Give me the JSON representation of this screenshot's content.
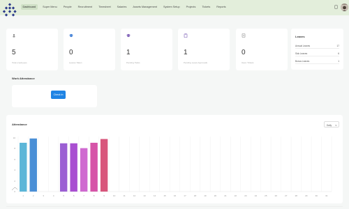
{
  "nav": {
    "items": [
      {
        "label": "Dashboard",
        "active": true
      },
      {
        "label": "Super Menu"
      },
      {
        "label": "People"
      },
      {
        "label": "Recruitment"
      },
      {
        "label": "Timesheet"
      },
      {
        "label": "Salaries"
      },
      {
        "label": "Assets Management"
      },
      {
        "label": "System Setup"
      },
      {
        "label": "Projects"
      },
      {
        "label": "Tickets"
      },
      {
        "label": "Reports"
      }
    ]
  },
  "kpis": [
    {
      "value": "5",
      "label": "Total employees",
      "icon": "people-icon",
      "color": "#888888"
    },
    {
      "value": "0",
      "label": "Leaves Taken",
      "icon": "graduation-cap-icon",
      "color": "#3a7bd5"
    },
    {
      "value": "1",
      "label": "Pending Tasks",
      "icon": "graduation-cap-icon",
      "color": "#7b5bb5"
    },
    {
      "value": "1",
      "label": "Pending Leave Approvals",
      "icon": "clipboard-icon",
      "color": "#7b5bb5"
    },
    {
      "value": "0",
      "label": "Open Tickets",
      "icon": "document-icon",
      "color": "#888888"
    }
  ],
  "leaves": {
    "title": "Leaves",
    "rows": [
      {
        "label": "Annual Leaves",
        "value": "17"
      },
      {
        "label": "Sick Leaves",
        "value": "6"
      },
      {
        "label": "Bonus Leaves",
        "value": "1"
      }
    ]
  },
  "work_attendance": {
    "title": "Work Attendance",
    "button_label": "Check In"
  },
  "attendance": {
    "title": "Attendance",
    "range_select": "Daily"
  },
  "colors": {
    "topbar": "#e3eedb",
    "accent": "#1f84e4"
  },
  "chart_data": {
    "type": "bar",
    "categories": [
      "1",
      "2",
      "3",
      "4",
      "5",
      "6",
      "7",
      "8",
      "9",
      "10",
      "11",
      "12",
      "13",
      "14",
      "15",
      "16",
      "17",
      "18",
      "19",
      "20",
      "21",
      "22",
      "23",
      "24",
      "25",
      "26",
      "27",
      "28",
      "29",
      "30",
      "31"
    ],
    "yticks": [
      "0",
      "2",
      "4",
      "6",
      "8",
      "10"
    ],
    "ylim": [
      0,
      10
    ],
    "values": [
      9.1,
      9.9,
      0,
      0,
      9.0,
      9.0,
      8.1,
      9.1,
      9.8,
      0,
      0,
      0,
      0,
      0,
      0,
      0,
      0,
      0,
      0,
      0,
      0,
      0,
      0,
      0,
      0,
      0,
      0,
      0,
      0,
      0,
      0
    ],
    "bar_colors": [
      "#5cb6d8",
      "#4a8fd6",
      "#cccccc",
      "#cccccc",
      "#9b5fd3",
      "#a94fd1",
      "#cf6ad0",
      "#d654a8",
      "#d8557b",
      "#cccccc",
      "#cccccc",
      "#cccccc",
      "#cccccc",
      "#cccccc",
      "#cccccc",
      "#cccccc",
      "#cccccc",
      "#cccccc",
      "#cccccc",
      "#cccccc",
      "#cccccc",
      "#cccccc",
      "#cccccc",
      "#cccccc",
      "#cccccc",
      "#cccccc",
      "#cccccc",
      "#cccccc",
      "#cccccc",
      "#cccccc",
      "#cccccc"
    ],
    "grid": true
  }
}
